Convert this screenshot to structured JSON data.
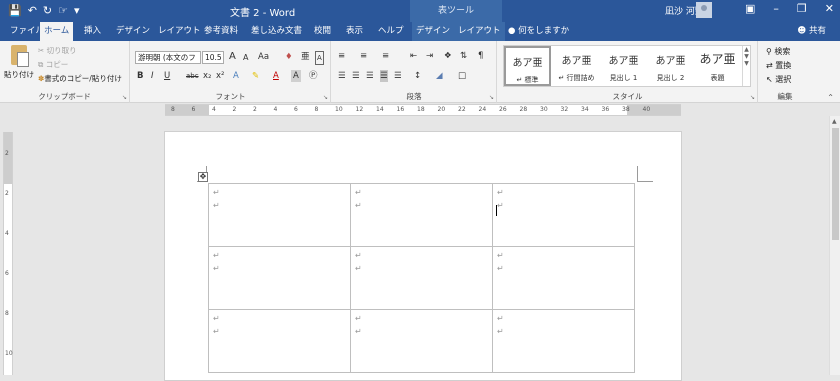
{
  "titlebar": {
    "qat_icons": [
      "save-icon",
      "undo-icon",
      "redo-icon",
      "touch-mode-icon",
      "customize-icon"
    ],
    "title": "文書 2  -  Word",
    "table_tools": "表ツール",
    "user": "凪沙 河野",
    "window_buttons": [
      "ribbon-display-icon",
      "minimize-icon",
      "restore-icon",
      "close-icon"
    ]
  },
  "tabs": [
    {
      "label": "ファイル"
    },
    {
      "label": "ホーム"
    },
    {
      "label": "挿入"
    },
    {
      "label": "デザイン"
    },
    {
      "label": "レイアウト"
    },
    {
      "label": "参考資料"
    },
    {
      "label": "差し込み文書"
    },
    {
      "label": "校閲"
    },
    {
      "label": "表示"
    },
    {
      "label": "ヘルプ"
    },
    {
      "label": "デザイン"
    },
    {
      "label": "レイアウト"
    }
  ],
  "tell_me": "何をしますか",
  "share": "共有",
  "clipboard": {
    "paste": "貼り付け",
    "cut": "切り取り",
    "copy": "コピー",
    "format_painter": "書式のコピー/貼り付け",
    "group": "クリップボード"
  },
  "font": {
    "name": "游明朝 (本文のフ",
    "size": "10.5",
    "grow": "A",
    "shrink": "A",
    "change_case": "Aa",
    "bold": "B",
    "italic": "I",
    "underline": "U",
    "strikethrough": "abc",
    "subscript": "x₂",
    "superscript": "x²",
    "group": "フォント"
  },
  "paragraph": {
    "group": "段落"
  },
  "styles": {
    "items": [
      {
        "sample": "あア亜",
        "name": "↵ 標準"
      },
      {
        "sample": "あア亜",
        "name": "↵ 行間詰め"
      },
      {
        "sample": "あア亜",
        "name": "見出し 1"
      },
      {
        "sample": "あア亜",
        "name": "見出し 2"
      },
      {
        "sample": "あア亜",
        "name": "表題"
      }
    ],
    "group": "スタイル"
  },
  "editing": {
    "find": "検索",
    "replace": "置換",
    "select": "選択",
    "group": "編集"
  },
  "ruler": {
    "h_labels": [
      "8",
      "6",
      "4",
      "2",
      "2",
      "4",
      "6",
      "8",
      "10",
      "12",
      "14",
      "16",
      "18",
      "20",
      "22",
      "24",
      "26",
      "28",
      "30",
      "32",
      "34",
      "36",
      "38",
      "40"
    ],
    "v_labels": [
      "2",
      "2",
      "4",
      "6",
      "8",
      "10"
    ]
  },
  "table": {
    "rows": [
      [
        [
          "↵",
          "↵"
        ],
        [
          "↵",
          "↵"
        ],
        [
          "↵",
          "↵"
        ]
      ],
      [
        [
          "↵",
          "↵"
        ],
        [
          "↵",
          "↵"
        ],
        [
          "↵",
          "↵"
        ]
      ],
      [
        [
          "↵",
          "↵"
        ],
        [
          "↵",
          "↵"
        ],
        [
          "↵",
          "↵"
        ]
      ]
    ]
  }
}
